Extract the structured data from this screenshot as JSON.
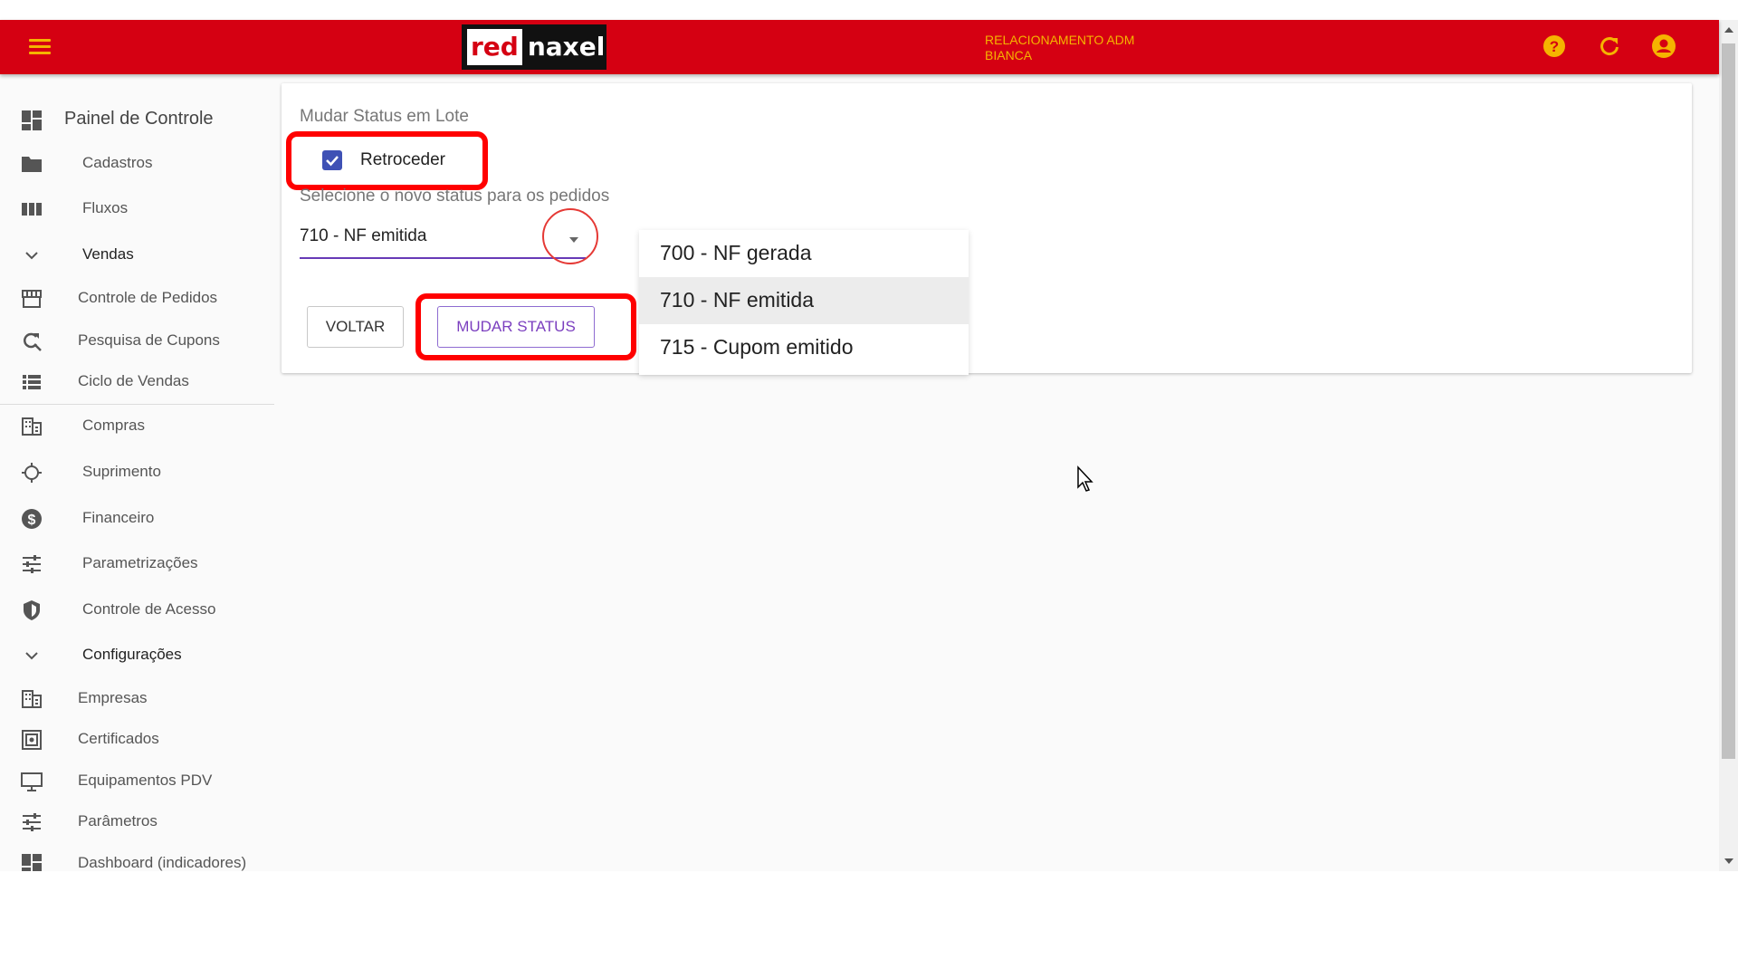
{
  "header": {
    "brand_red": "red",
    "brand_rest": "naxel",
    "user_line1": "RELACIONAMENTO ADM",
    "user_line2": "BIANCA",
    "accent_color": "#f5b400",
    "bar_color": "#d50012",
    "icons": [
      "menu-icon",
      "help-icon",
      "refresh-icon",
      "account-icon"
    ]
  },
  "sidebar": {
    "items": [
      {
        "label": "Painel de Controle",
        "icon": "dashboard-icon"
      },
      {
        "label": "Cadastros",
        "icon": "folder-icon"
      },
      {
        "label": "Fluxos",
        "icon": "columns-icon"
      },
      {
        "label": "Vendas",
        "icon": "chevron-down-icon"
      },
      {
        "label": "Controle de Pedidos",
        "icon": "storefront-icon"
      },
      {
        "label": "Pesquisa de Cupons",
        "icon": "search-refresh-icon"
      },
      {
        "label": "Ciclo de Vendas",
        "icon": "list-icon"
      },
      {
        "label": "Compras",
        "icon": "building-icon"
      },
      {
        "label": "Suprimento",
        "icon": "target-icon"
      },
      {
        "label": "Financeiro",
        "icon": "dollar-icon"
      },
      {
        "label": "Parametrizações",
        "icon": "tune-icon"
      },
      {
        "label": "Controle de Acesso",
        "icon": "shield-icon"
      },
      {
        "label": "Configurações",
        "icon": "chevron-down-icon"
      },
      {
        "label": "Empresas",
        "icon": "building-icon"
      },
      {
        "label": "Certificados",
        "icon": "certificate-icon"
      },
      {
        "label": "Equipamentos PDV",
        "icon": "monitor-icon"
      },
      {
        "label": "Parâmetros",
        "icon": "tune-icon"
      },
      {
        "label": "Dashboard (indicadores)",
        "icon": "dashboard-icon"
      }
    ]
  },
  "form": {
    "title": "Mudar Status em Lote",
    "retroceder_label": "Retroceder",
    "retroceder_checked": true,
    "select_label": "Selecione o novo status para os pedidos",
    "selected_status": "710 - NF emitida",
    "voltar_label": "VOLTAR",
    "mudar_status_label": "MUDAR STATUS"
  },
  "dropdown": {
    "options": [
      "700 - NF gerada",
      "710 - NF emitida",
      "715 - Cupom emitido"
    ],
    "highlighted": "710 - NF emitida"
  }
}
